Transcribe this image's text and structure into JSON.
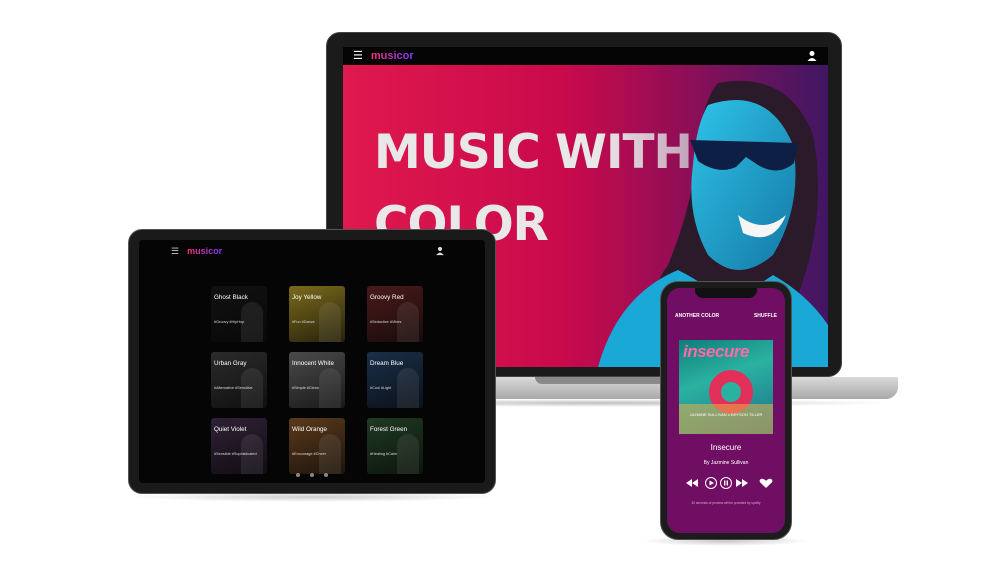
{
  "brand": "musicor",
  "laptop": {
    "hero_title": "MUSIC WITH COLOR"
  },
  "tablet": {
    "cards": [
      {
        "name": "Ghost Black",
        "tags": "#Groovy #HipHop",
        "color": "#111111"
      },
      {
        "name": "Joy Yellow",
        "tags": "#Fun #Dance",
        "color": "#7a6a1c"
      },
      {
        "name": "Groovy Red",
        "tags": "#Seductive #Vibes",
        "color": "#4a1a1a"
      },
      {
        "name": "Urban Gray",
        "tags": "#Alternative #Sensitive",
        "color": "#2b2b2b"
      },
      {
        "name": "Innocent White",
        "tags": "#Simple #Clean",
        "color": "#4b4b4b"
      },
      {
        "name": "Dream Blue",
        "tags": "#Cool #Light",
        "color": "#1a2f4a"
      },
      {
        "name": "Quiet Violet",
        "tags": "#Sensible #Sophisticated",
        "color": "#2f2136"
      },
      {
        "name": "Wild Orange",
        "tags": "#Encourage #Cheer",
        "color": "#5a3a1c"
      },
      {
        "name": "Forest Green",
        "tags": "#Healing #Calm",
        "color": "#1f3a22"
      }
    ]
  },
  "phone": {
    "another_color": "ANOTHER COLOR",
    "shuffle": "SHUFFLE",
    "cover_title": "insecure",
    "cover_subtitle": "JAZMINE SULLIVAN  x  BRYSON TILLER",
    "song_title": "Insecure",
    "artist": "By Jazmine Sullivan",
    "preview_note": "30 seconds of preview will be provided by spotify"
  },
  "colors": {
    "hero_red": "#c90a4b",
    "phone_purple": "#700e63",
    "brand_pink": "#ff2d7a",
    "brand_violet": "#7b3cff"
  },
  "icons": [
    "hamburger-menu-icon",
    "user-icon",
    "rewind-icon",
    "play-icon",
    "pause-icon",
    "fast-forward-icon",
    "heart-icon"
  ]
}
